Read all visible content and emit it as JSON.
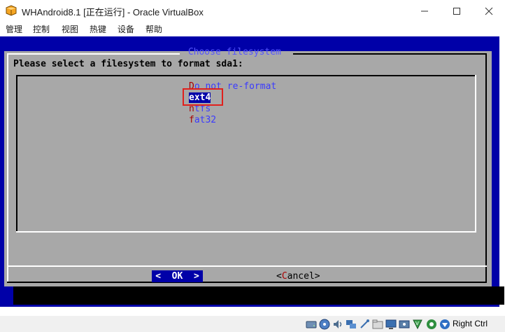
{
  "window": {
    "title": "WHAndroid8.1 [正在运行] - Oracle VirtualBox",
    "icons": [
      "virtualbox-logo-icon",
      "minimize-icon",
      "maximize-icon",
      "close-icon"
    ]
  },
  "menu": {
    "items": [
      "管理",
      "控制",
      "视图",
      "热键",
      "设备",
      "帮助"
    ]
  },
  "dialog": {
    "title": " Choose filesystem ",
    "prompt": "Please select a filesystem to format sda1:",
    "options": [
      {
        "hotkey": "D",
        "rest": "o not re-format"
      },
      {
        "hotkey": "e",
        "rest": "xt4"
      },
      {
        "hotkey": "n",
        "rest": "tfs"
      },
      {
        "hotkey": "f",
        "rest": "at32"
      }
    ],
    "selected_index": 1,
    "ok_label": "<  OK  >",
    "cancel_prefix": "<",
    "cancel_hotkey": "C",
    "cancel_rest": "ancel>"
  },
  "colors": {
    "vm_background": "#0000a8",
    "dialog_background": "#a8a8a8",
    "hotkey": "#a80000",
    "option_text": "#3a3aff",
    "highlight_outline": "#e0201c"
  },
  "statusbar": {
    "icons": [
      "hard-disk-icon",
      "optical-drive-icon",
      "audio-icon",
      "network-icon",
      "usb-icon",
      "shared-folder-icon",
      "display-icon",
      "video-capture-icon",
      "virtualization-icon",
      "mouse-integration-icon",
      "arrow-down-icon"
    ],
    "host_key": "Right Ctrl"
  }
}
